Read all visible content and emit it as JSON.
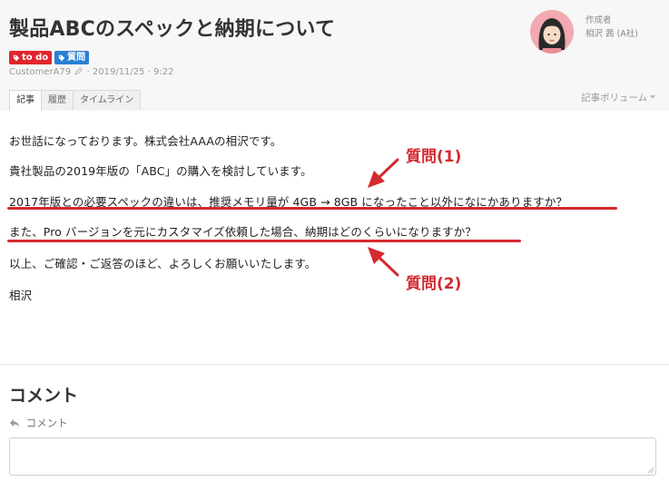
{
  "article": {
    "title": "製品ABCのスペックと納期について",
    "tags": [
      {
        "label": "to do",
        "color": "#e0262c"
      },
      {
        "label": "質問",
        "color": "#2a7fd4"
      }
    ],
    "author_id": "CustomerA79",
    "meta_suffix": "· 2019/11/25 · 9:22",
    "author_label": "作成者",
    "author_name": "相沢 茜 (A社)"
  },
  "tabs": [
    {
      "label": "記事",
      "active": true
    },
    {
      "label": "履歴",
      "active": false
    },
    {
      "label": "タイムライン",
      "active": false
    }
  ],
  "volume_label": "記事ボリューム",
  "body": {
    "paragraphs": [
      "お世話になっております。株式会社AAAの相沢です。",
      "貴社製品の2019年版の「ABC」の購入を検討しています。",
      "2017年版との必要スペックの違いは、推奨メモリ量が 4GB → 8GB になったこと以外になにかありますか？",
      "また、Pro バージョンを元にカスタマイズ依頼した場合、納期はどのくらいになりますか？",
      "以上、ご確認・ご返答のほど、よろしくお願いいたします。",
      "相沢"
    ]
  },
  "annotations": {
    "q1_label": "質問(1)",
    "q2_label": "質問(2)",
    "color": "#d42a2f"
  },
  "comments": {
    "heading": "コメント",
    "reply_label": "コメント",
    "input_value": ""
  }
}
